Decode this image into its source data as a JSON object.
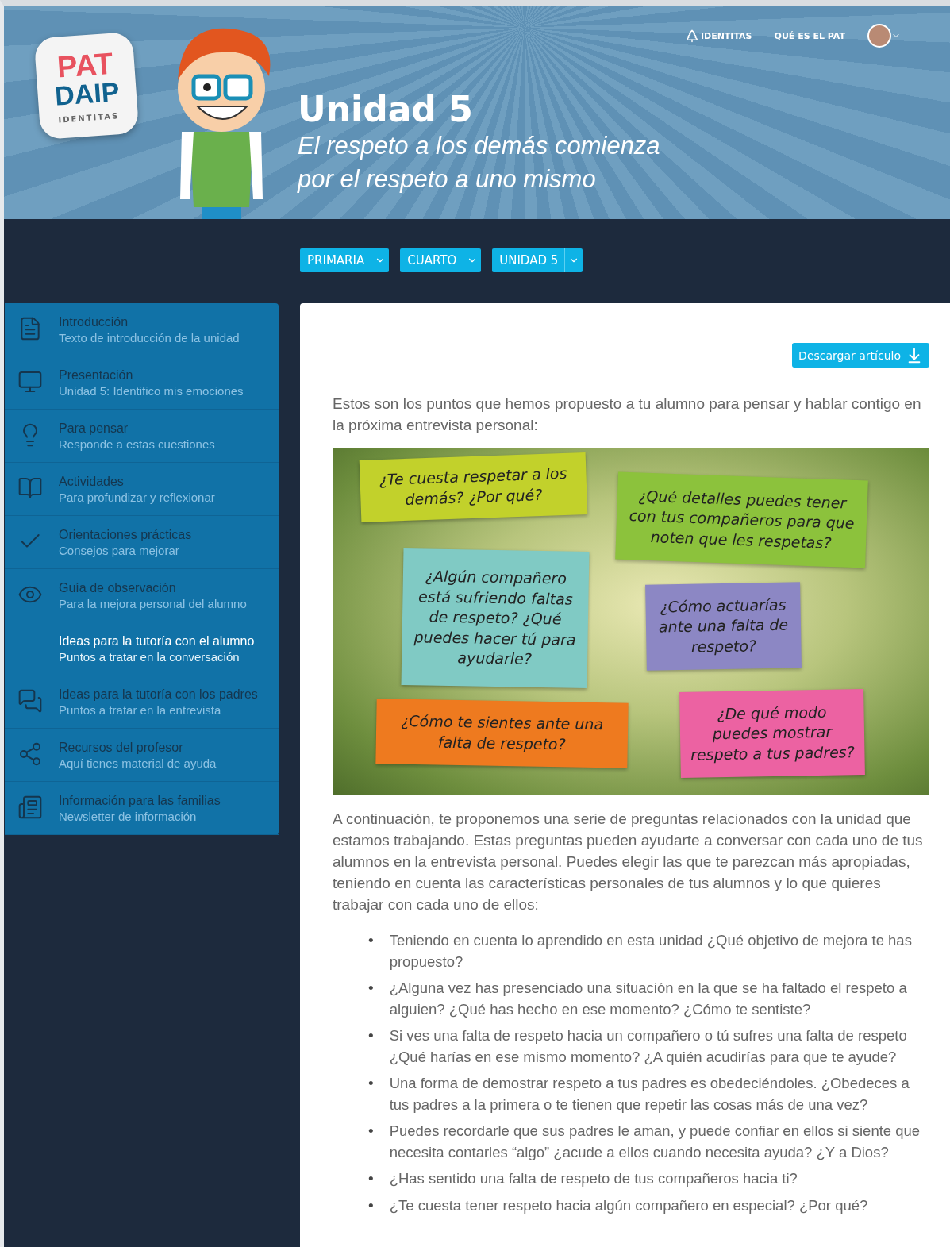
{
  "header": {
    "logo": {
      "top": "PAT",
      "bottom": "DAIP",
      "caption": "IDENTITAS"
    },
    "nav": [
      "IDENTITAS",
      "QUÉ ES EL PAT"
    ],
    "title": "Unidad 5",
    "subtitle": "El respeto a los demás comienza por el respeto a uno mismo"
  },
  "selectors": [
    "PRIMARIA",
    "CUARTO",
    "UNIDAD 5"
  ],
  "sidebar": {
    "items": [
      {
        "title": "Introducción",
        "subtitle": "Texto de introducción de la unidad",
        "selected": false
      },
      {
        "title": "Presentación",
        "subtitle": "Unidad 5: Identifico mis emociones",
        "selected": false
      },
      {
        "title": "Para pensar",
        "subtitle": "Responde a estas cuestiones",
        "selected": false
      },
      {
        "title": "Actividades",
        "subtitle": "Para profundizar y reflexionar",
        "selected": false
      },
      {
        "title": "Orientaciones prácticas",
        "subtitle": "Consejos para mejorar",
        "selected": false
      },
      {
        "title": "Guía de observación",
        "subtitle": "Para la mejora personal del alumno",
        "selected": false
      },
      {
        "title": "Ideas para la tutoría con el alumno",
        "subtitle": "Puntos a tratar en la conversación",
        "selected": true
      },
      {
        "title": "Ideas para la tutoría con los padres",
        "subtitle": "Puntos a tratar en la entrevista",
        "selected": false
      },
      {
        "title": "Recursos del profesor",
        "subtitle": "Aquí tienes material de ayuda",
        "selected": false
      },
      {
        "title": "Información para las familias",
        "subtitle": "Newsletter de información",
        "selected": false
      }
    ]
  },
  "article": {
    "download": "Descargar artículo",
    "intro": "Estos son los puntos que hemos propuesto a tu alumno para pensar y hablar contigo en la próxima entrevista personal:",
    "notes": [
      {
        "text": "¿Te cuesta respetar a los demás? ¿Por qué?",
        "color": "#c2d12b"
      },
      {
        "text": "¿Qué detalles puedes tener con tus compañeros para que noten que les respetas?",
        "color": "#8cc23c"
      },
      {
        "text": "¿Algún compañero está sufriendo faltas de respeto? ¿Qué puedes hacer tú para ayudarle?",
        "color": "#80cac4"
      },
      {
        "text": "¿Cómo actuarías ante una falta de respeto?",
        "color": "#8c87c4"
      },
      {
        "text": "¿Cómo te sientes ante una falta de respeto?",
        "color": "#ee7a1f"
      },
      {
        "text": "¿De qué modo puedes mostrar respeto a tus padres?",
        "color": "#ec62a2"
      }
    ],
    "body": "A continuación, te proponemos una serie de preguntas relacionados con la unidad que estamos trabajando. Estas preguntas pueden ayudarte a conversar con cada uno de tus alumnos en la entrevista personal. Puedes elegir las que te parezcan más apropiadas, teniendo en cuenta las características personales de tus alumnos y lo que quieres trabajar con cada uno de ellos:",
    "questions": [
      {
        "marker": "•",
        "text": "Teniendo en cuenta lo aprendido en esta unidad ¿Qué objetivo de mejora te has propuesto?"
      },
      {
        "marker": "•",
        "text": "¿Alguna vez has presenciado una situación en la que se ha faltado el respeto a alguien? ¿Qué has hecho en ese momento? ¿Cómo te sentiste?"
      },
      {
        "marker": "•",
        "text": "Si ves una falta de respeto hacia un compañero o tú sufres una falta de respeto ¿Qué harías en ese mismo momento? ¿A quién acudirías para que te ayude?"
      },
      {
        "marker": "•",
        "text": "Una forma de demostrar respeto a tus padres es obedeciéndoles. ¿Obedeces a tus padres a la primera o te tienen que repetir las cosas más de una vez?"
      },
      {
        "marker": "•",
        "text": "Puedes recordarle que sus padres le aman, y puede confiar en ellos si siente que necesita contarles “algo” ¿acude a ellos cuando necesita ayuda? ¿Y a Dios?"
      },
      {
        "marker": "•",
        "text": "¿Has sentido una falta de respeto de tus compañeros hacia ti?"
      },
      {
        "marker": "•",
        "text": "¿Te cuesta tener respeto hacia algún compañero en especial? ¿Por qué?"
      }
    ]
  }
}
